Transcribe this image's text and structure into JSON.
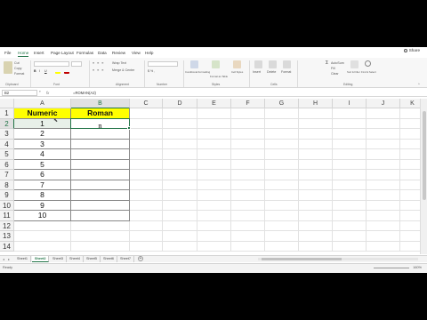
{
  "menu": {
    "items": [
      "File",
      "Home",
      "Insert",
      "Page Layout",
      "Formulas",
      "Data",
      "Review",
      "View",
      "Help"
    ],
    "active": "Home",
    "share": "Share"
  },
  "ribbon": {
    "clipboard": {
      "label": "Clipboard",
      "cut": "Cut",
      "copy": "Copy",
      "format": "Format"
    },
    "font": {
      "label": "Font"
    },
    "alignment": {
      "label": "Alignment",
      "wrap": "Wrap Text",
      "merge": "Merge & Center"
    },
    "number": {
      "label": "Number"
    },
    "styles": {
      "label": "Styles",
      "conditional": "Conditional Formatting",
      "format_table": "Format as Table",
      "cell_styles": "Cell Styles"
    },
    "cells": {
      "label": "Cells",
      "insert": "Insert",
      "delete": "Delete",
      "format": "Format"
    },
    "editing": {
      "label": "Editing",
      "autosum": "AutoSum",
      "fill": "Fill",
      "clear": "Clear",
      "sort": "Sort & Filter",
      "find": "Find & Select"
    }
  },
  "formula_bar": {
    "name_box": "B2",
    "fx": "fx",
    "formula": "=ROMAN(A2)"
  },
  "grid": {
    "columns": [
      "A",
      "B",
      "C",
      "D",
      "E",
      "F",
      "G",
      "H",
      "I",
      "J",
      "K"
    ],
    "rows": [
      "1",
      "2",
      "3",
      "4",
      "5",
      "6",
      "7",
      "8",
      "9",
      "10",
      "11",
      "12",
      "13",
      "14"
    ],
    "header_row": {
      "a": "Numeric",
      "b": "Roman"
    },
    "numeric": [
      "1",
      "2",
      "3",
      "4",
      "5",
      "6",
      "7",
      "8",
      "9",
      "10"
    ],
    "b2_value": "n"
  },
  "sheet_tabs": {
    "tabs": [
      "Sheet1",
      "Sheet2",
      "Sheet3",
      "Sheet4",
      "Sheet5",
      "Sheet6",
      "Sheet7"
    ],
    "active": "Sheet2",
    "add": "+"
  },
  "status": {
    "ready": "Ready",
    "zoom": "160%"
  },
  "colors": {
    "accent": "#217346",
    "header_fill": "#ffff00"
  }
}
